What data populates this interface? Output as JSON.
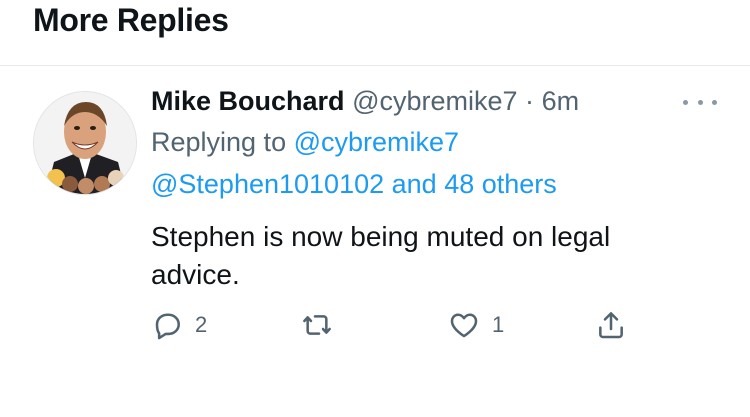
{
  "section": {
    "title": "More Replies"
  },
  "tweet": {
    "author": "Mike Bouchard",
    "handle": "@cybremike7",
    "separator": "·",
    "time": "6m",
    "replying_prefix": "Replying to",
    "replying_to_1": "@cybremike7",
    "replying_to_2": "@Stephen1010102",
    "replying_and": "and",
    "replying_others": "48 others",
    "text": "Stephen is now being muted on legal advice."
  },
  "actions": {
    "reply_count": "2",
    "like_count": "1"
  },
  "icons": {
    "more": "more-horizontal-icon",
    "reply": "reply-icon",
    "retweet": "retweet-icon",
    "like": "heart-icon",
    "share": "share-icon"
  },
  "colors": {
    "link": "#1d9bf0",
    "muted": "#536471",
    "text": "#0f1419"
  }
}
